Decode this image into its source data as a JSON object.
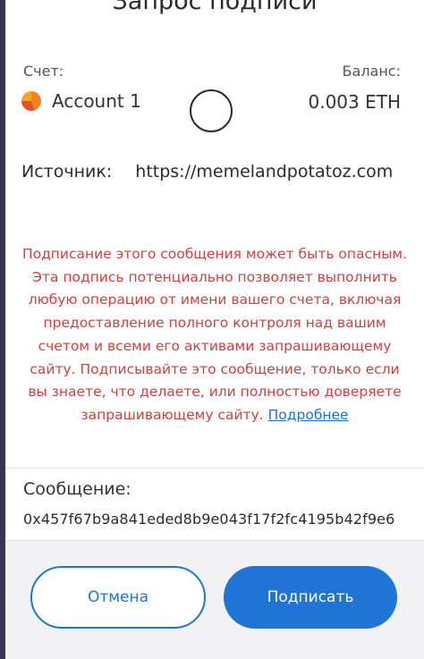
{
  "header": {
    "title": "Запрос подписи"
  },
  "account": {
    "label": "Счет:",
    "name": "Account 1",
    "balance_label": "Баланс:",
    "balance_value": "0.003 ETH"
  },
  "source": {
    "label": "Источник:",
    "url": "https://memelandpotatoz.com"
  },
  "warning": {
    "text": "Подписание этого сообщения может быть опасным. Эта подпись потенциально позволяет выполнить любую операцию от имени вашего счета, включая предоставление полного контроля над вашим счетом и всеми его активами запрашивающему сайту. Подписывайте это сообщение, только если вы знаете, что делаете, или полностью доверяете запрашивающему сайту.",
    "link": "Подробнее",
    "color": "#d0413f",
    "link_color": "#1d6fd8"
  },
  "message": {
    "label": "Сообщение:",
    "value": "0x457f67b9a841eded8b9e043f17f2fc4195b42f9e6"
  },
  "footer": {
    "cancel_label": "Отмена",
    "sign_label": "Подписать",
    "accent_color": "#1f74d6"
  }
}
